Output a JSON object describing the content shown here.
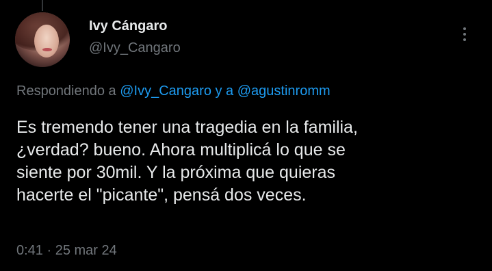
{
  "author": {
    "name": "Ivy Cángaro",
    "handle": "@Ivy_Cangaro"
  },
  "reply_context": {
    "prefix": "Respondiendo a ",
    "user1": "@Ivy_Cangaro",
    "connector": " y a ",
    "user2": "@agustinromm"
  },
  "tweet": {
    "lines": [
      "Es tremendo tener una tragedia en la familia,",
      "¿verdad? bueno. Ahora multiplicá lo que se",
      "siente por 30mil. Y la próxima que quieras",
      "hacerte el \"picante\", pensá dos veces."
    ]
  },
  "meta": {
    "time": "0:41",
    "separator": " · ",
    "date": "25 mar 24"
  },
  "icons": {
    "more": "more-vertical-icon"
  },
  "colors": {
    "background": "#000000",
    "text": "#e7e9ea",
    "secondary": "#71767b",
    "link": "#1d9bf0"
  }
}
